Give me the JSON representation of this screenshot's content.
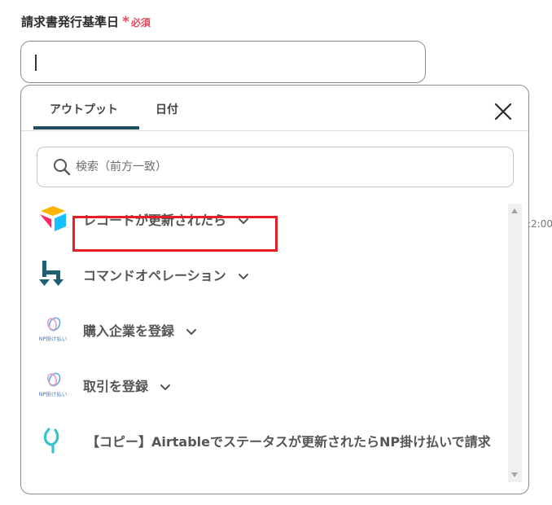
{
  "field": {
    "label": "請求書発行基準日",
    "required_mark": "*",
    "required_text": "必須",
    "value": ""
  },
  "side_fragment": ":2:00",
  "tabs": [
    {
      "label": "アウトプット",
      "active": true
    },
    {
      "label": "日付",
      "active": false
    }
  ],
  "search": {
    "placeholder": "検索（前方一致）"
  },
  "items": [
    {
      "label": "レコードが更新されたら",
      "icon": "airtable-icon",
      "highlighted": true
    },
    {
      "label": "コマンドオペレーション",
      "icon": "command-operation-icon"
    },
    {
      "label": "購入企業を登録",
      "icon": "np-kakebarai-icon"
    },
    {
      "label": "取引を登録",
      "icon": "np-kakebarai-icon"
    },
    {
      "label": "【コピー】Airtableでステータスが更新されたらNP掛け払いで請求",
      "icon": "yoom-icon"
    }
  ],
  "icon_texts": {
    "np": "NP掛け払い"
  },
  "colors": {
    "required": "#e5485d",
    "tab_underline": "#1f4f5f",
    "highlight_border": "#e51d24",
    "command_icon": "#1e6073",
    "yoom_icon": "#36c3c9"
  }
}
